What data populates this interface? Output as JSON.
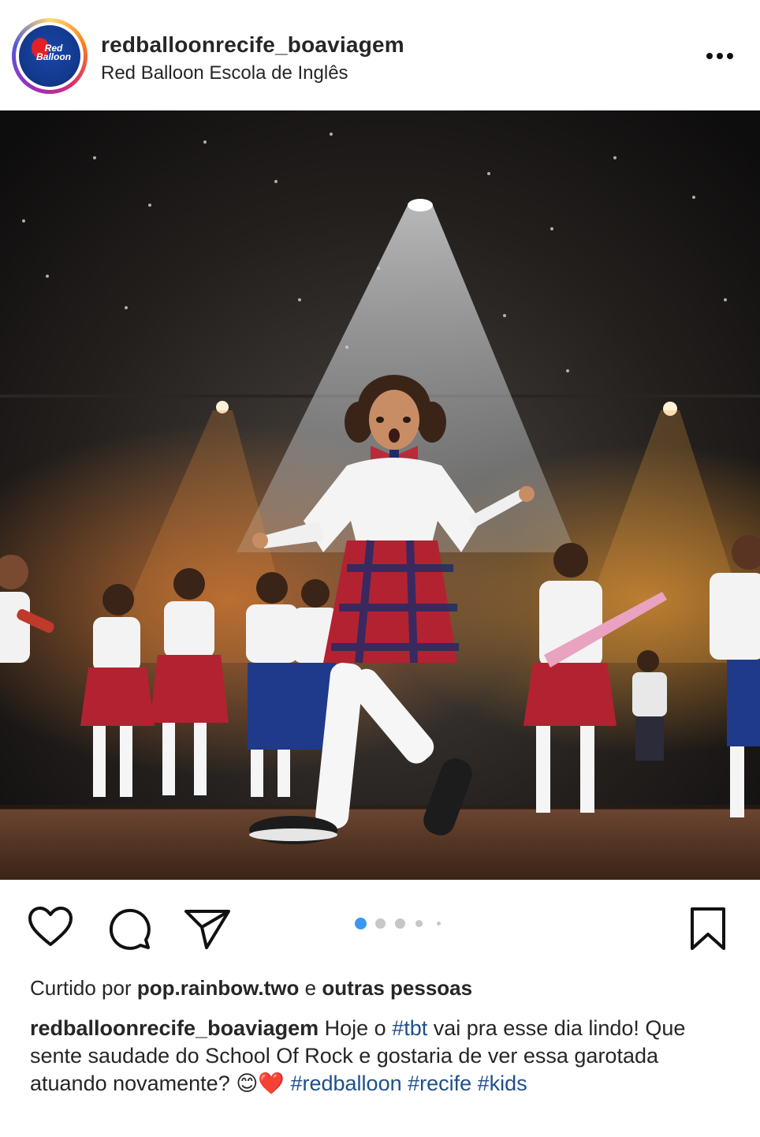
{
  "header": {
    "avatar_logo_text": "Red Balloon",
    "username": "redballoonrecife_boaviagem",
    "subtitle": "Red Balloon Escola de Inglês"
  },
  "post": {
    "image_icon": "stage-performance-photo",
    "carousel": {
      "count": 5,
      "active_index": 0
    }
  },
  "actions": {
    "like_icon": "heart-icon",
    "comment_icon": "comment-icon",
    "share_icon": "paper-plane-icon",
    "save_icon": "bookmark-icon"
  },
  "likes": {
    "prefix": "Curtido por ",
    "user": "pop.rainbow.two",
    "middle": " e ",
    "others": "outras pessoas"
  },
  "caption": {
    "username": "redballoonrecife_boaviagem",
    "text1": " Hoje o ",
    "tag_tbt": "#tbt",
    "text2": " vai pra esse dia lindo! Que sente saudade do School Of Rock e gostaria de ver essa garotada atuando novamente? ",
    "emoji": "😊❤️",
    "tag_redballoon": " #redballoon",
    "tag_recife": " #recife",
    "tag_kids": " #kids"
  },
  "colors": {
    "accent_blue": "#3897f0",
    "hashtag": "#1f4f8c"
  }
}
